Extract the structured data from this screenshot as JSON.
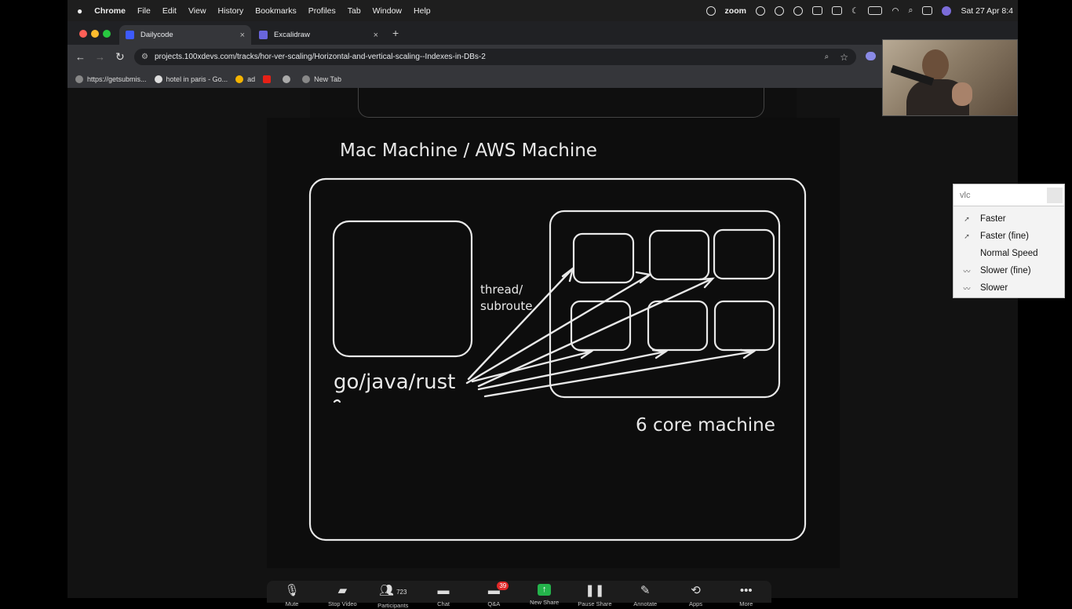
{
  "menubar": {
    "apple": "",
    "app": "Chrome",
    "menus": [
      "File",
      "Edit",
      "View",
      "History",
      "Bookmarks",
      "Profiles",
      "Tab",
      "Window",
      "Help"
    ],
    "zoom_label": "zoom",
    "datetime": "Sat 27 Apr  8:4"
  },
  "tabs": [
    {
      "title": "Dailycode",
      "close": "×"
    },
    {
      "title": "Excalidraw",
      "close": "×"
    }
  ],
  "new_tab": "+",
  "url": "projects.100xdevs.com/tracks/hor-ver-scaling/Horizontal-and-vertical-scaling--Indexes-in-DBs-2",
  "bookmarks": [
    "https://getsubmis...",
    "hotel in paris - Go...",
    "ad",
    "",
    "",
    " New Tab"
  ],
  "slide": {
    "title": "Mac Machine / AWS Machine",
    "lang": "go/java/rust",
    "thread": "thread/",
    "subroutine": "subroute",
    "core": "6 core machine"
  },
  "vlc": {
    "query": "vlc",
    "items": [
      "Faster",
      "Faster (fine)",
      "Normal Speed",
      "Slower (fine)",
      "Slower"
    ]
  },
  "zoom_bar": {
    "participants_count": "723",
    "qa_badge": "39",
    "items": [
      "Mute",
      "Stop Video",
      "Participants",
      "Chat",
      "Q&A",
      "New Share",
      "Pause Share",
      "Annotate",
      "Apps",
      "More"
    ]
  }
}
